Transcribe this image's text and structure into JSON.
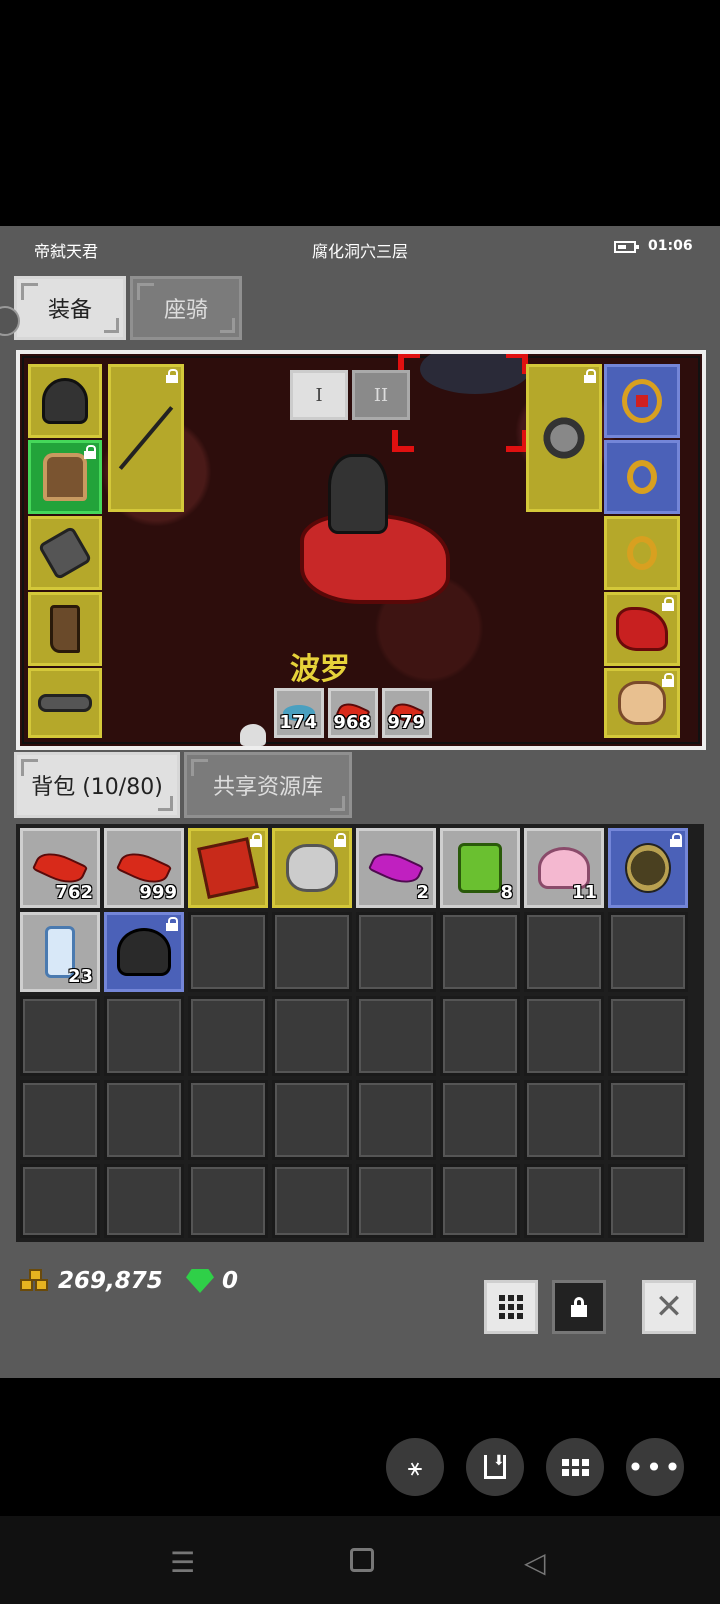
{
  "status_bar": {
    "player_name": "帝弑天君",
    "location": "腐化洞穴三层",
    "time": "01:06"
  },
  "tabs": {
    "equipment": "装备",
    "mount": "座骑"
  },
  "equipment_page": {
    "page_1": "I",
    "page_2": "II"
  },
  "character": {
    "name": "波罗"
  },
  "quick_items": [
    {
      "icon": "fish-icon",
      "count": "174"
    },
    {
      "icon": "red-feather-icon",
      "count": "968"
    },
    {
      "icon": "red-feather-icon",
      "count": "979"
    }
  ],
  "bag_tabs": {
    "backpack": "背包 (10/80)",
    "shared": "共享资源库"
  },
  "inventory": [
    {
      "icon": "red-feather-icon",
      "count": "762"
    },
    {
      "icon": "red-feather-icon",
      "count": "999"
    },
    {
      "icon": "dragon-book-icon",
      "count": ""
    },
    {
      "icon": "cat-pet-icon",
      "count": ""
    },
    {
      "icon": "purple-feather-icon",
      "count": "2"
    },
    {
      "icon": "green-gift-icon",
      "count": "8"
    },
    {
      "icon": "pink-cake-icon",
      "count": "11"
    },
    {
      "icon": "round-shield-icon",
      "count": ""
    },
    {
      "icon": "scroll-icon",
      "count": "23"
    },
    {
      "icon": "horned-helmet-icon",
      "count": ""
    }
  ],
  "currency": {
    "gold": "269,875",
    "gems": "0"
  },
  "colors": {
    "rarity_yellow": "#b5a82a",
    "rarity_blue": "#4b61b8",
    "rarity_green": "#22a33a",
    "name_gold": "#e6d23a"
  }
}
